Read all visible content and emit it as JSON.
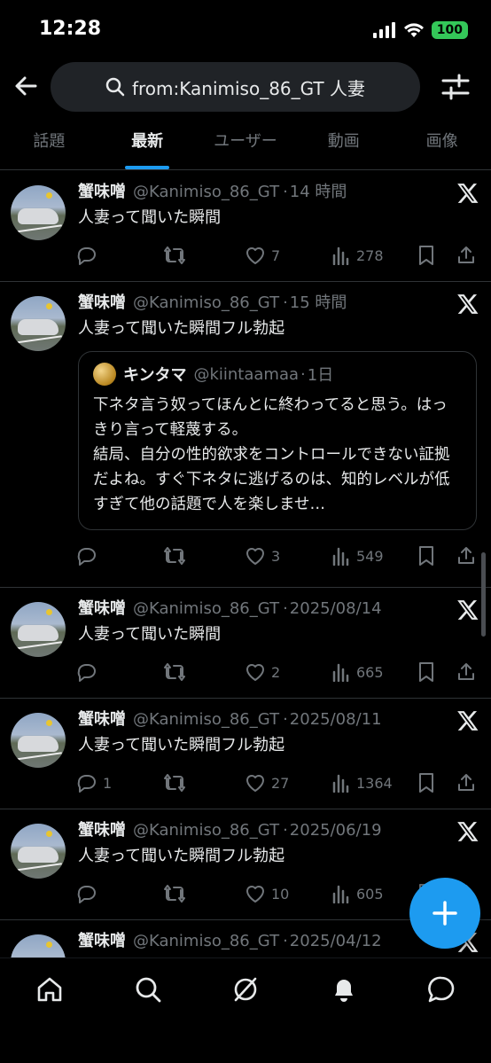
{
  "status_bar": {
    "time": "12:28",
    "battery": "100"
  },
  "search": {
    "query": "from:Kanimiso_86_GT 人妻"
  },
  "tabs": [
    "話題",
    "最新",
    "ユーザー",
    "動画",
    "画像"
  ],
  "active_tab": "最新",
  "posts": [
    {
      "name": "蟹味噌",
      "handle": "@Kanimiso_86_GT",
      "time": "14 時間",
      "text": "人妻って聞いた瞬間",
      "replies": "",
      "likes": "7",
      "views": "278"
    },
    {
      "name": "蟹味噌",
      "handle": "@Kanimiso_86_GT",
      "time": "15 時間",
      "text": "人妻って聞いた瞬間フル勃起",
      "quote": {
        "name": "キンタマ",
        "handle": "@kiintaamaa",
        "time": "1日",
        "text": "下ネタ言う奴ってほんとに終わってると思う。はっきり言って軽蔑する。\n結局、自分の性的欲求をコントロールできない証拠だよね。すぐ下ネタに逃げるのは、知的レベルが低すぎて他の話題で人を楽しませ…"
      },
      "replies": "",
      "likes": "3",
      "views": "549"
    },
    {
      "name": "蟹味噌",
      "handle": "@Kanimiso_86_GT",
      "time": "2025/08/14",
      "text": "人妻って聞いた瞬間",
      "replies": "",
      "likes": "2",
      "views": "665"
    },
    {
      "name": "蟹味噌",
      "handle": "@Kanimiso_86_GT",
      "time": "2025/08/11",
      "text": "人妻って聞いた瞬間フル勃起",
      "replies": "1",
      "likes": "27",
      "views": "1364"
    },
    {
      "name": "蟹味噌",
      "handle": "@Kanimiso_86_GT",
      "time": "2025/06/19",
      "text": "人妻って聞いた瞬間フル勃起",
      "replies": "",
      "likes": "10",
      "views": "605"
    },
    {
      "name": "蟹味噌",
      "handle": "@Kanimiso_86_GT",
      "time": "2025/04/12",
      "text": "",
      "replies": "",
      "likes": "",
      "views": ""
    }
  ],
  "colors": {
    "accent": "#1d9bf0",
    "background": "#000000",
    "text": "#e7e9ea",
    "muted": "#71767b",
    "divider": "#2f3336"
  },
  "nav_icons": [
    "home-icon",
    "search-icon",
    "grok-icon",
    "notifications-icon",
    "messages-icon"
  ]
}
